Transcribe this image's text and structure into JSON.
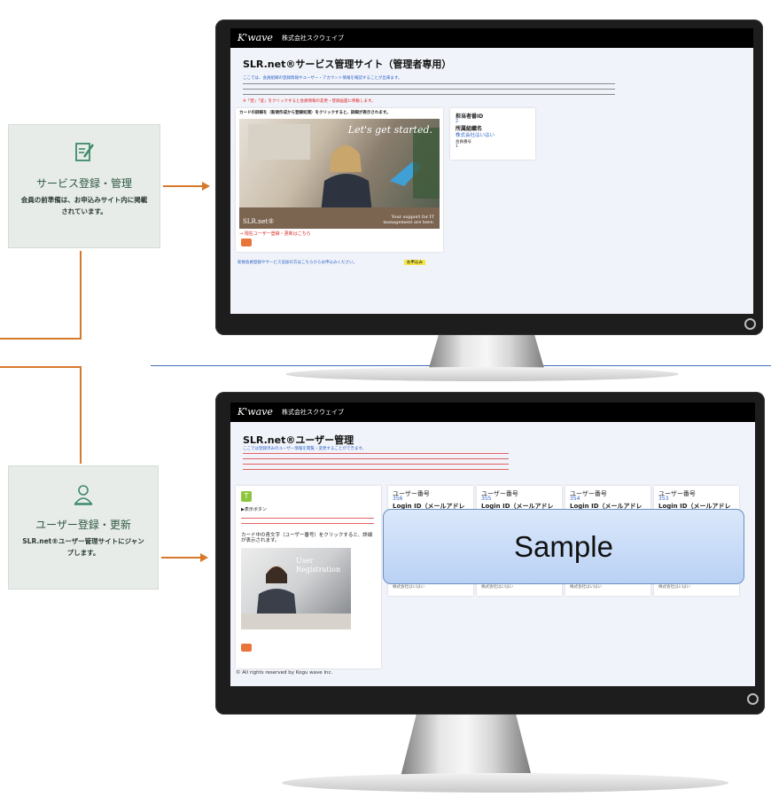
{
  "colors": {
    "accent": "#d8782a",
    "card_bg": "#e7ece8",
    "divider": "#3f6fb4",
    "screen_bg": "#f1f3fa"
  },
  "cards": [
    {
      "icon": "edit-note-icon",
      "title": "サービス登録・管理",
      "desc": "会員の前準備は、お申込みサイト内に掲載されています。"
    },
    {
      "icon": "user-icon",
      "title": "ユーザー登録・更新",
      "desc": "SLR.net®ユーザー管理サイトにジャンプします。"
    }
  ],
  "site": {
    "logo": "K'wave",
    "company": "株式会社スクウェイブ"
  },
  "screen1": {
    "title": "SLR.net®サービス管理サイト（管理者専用）",
    "intro": "ここでは、会員組織の登録情報やユーザー・アカウント情報を確認することが出来ます。",
    "note_red": "※「登」「変」をクリックすると会員情報の変更・登録画面に移動します。",
    "panel_head": "カードの詳細を（新規作成から登録処理）をクリックすると、詳細が表示されます。",
    "banner": "Let's get started.",
    "brand": "SLR.net®",
    "photo_caption": "Your support for IT management are here.",
    "panel_link": "→ 現在ユーザー登録・更新はこちら",
    "side_card": {
      "l1": "担当者番ID",
      "l2": "2",
      "l3": "所属組織名",
      "l4": "株式会社はいはい",
      "l5": "会員番号",
      "l6": "1"
    },
    "footer_line": "新規会員登録やサービス追加の方はこちらからお申込みください。",
    "footer_badge": "お申込み"
  },
  "screen2": {
    "title": "SLR.net®ユーザー管理",
    "intro": "ここでは登録済みのユーザー情報を閲覧・変更することができます。",
    "sidebar_title": "▶表示ボタン",
    "sidebar_desc": "カード中の青文字（ユーザー番号）をクリックすると、詳細が表示されます。",
    "photo_text": "User Registration",
    "footer_rights": "© All rights reserved by Kogu wave Inc.",
    "cards": [
      {
        "label": "ユーザー番号",
        "num": "356",
        "login": "Login ID（メールアドレス）",
        "group": "株式会社はいはい"
      },
      {
        "label": "ユーザー番号",
        "num": "355",
        "login": "Login ID（メールアドレス）",
        "group": "株式会社はいはい"
      },
      {
        "label": "ユーザー番号",
        "num": "354",
        "login": "Login ID（メールアドレス）",
        "group": "株式会社はいはい"
      },
      {
        "label": "ユーザー番号",
        "num": "353",
        "login": "Login ID（メールアドレス）",
        "group": "株式会社はいはい"
      }
    ]
  },
  "watermark": "Sample"
}
